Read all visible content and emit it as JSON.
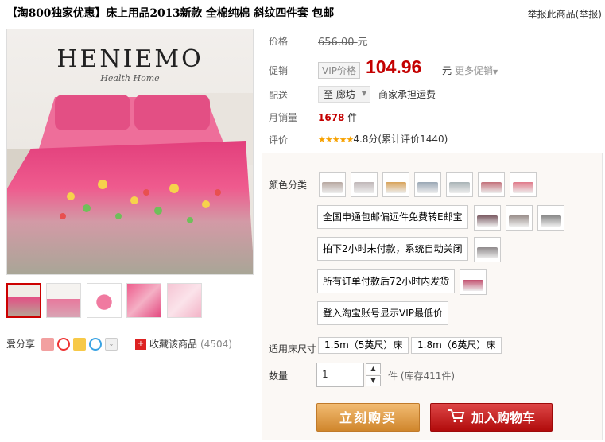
{
  "title": "【淘800独家优惠】床上用品2013新款 全棉纯棉 斜纹四件套 包邮",
  "report_link": "举报此商品(举报)",
  "gallery": {
    "brand": "HENIEMO",
    "brand_sub": "Health Home"
  },
  "share": {
    "label": "爱分享"
  },
  "favorite": {
    "label": "收藏该商品",
    "count": "(4504)"
  },
  "price": {
    "label": "价格",
    "original": "656.00",
    "unit": "元"
  },
  "promo": {
    "label": "促销",
    "tag": "VIP价格",
    "price": "104.96",
    "unit": "元",
    "more": "更多促销"
  },
  "shipping": {
    "label": "配送",
    "location": "至 廊坊",
    "note": "商家承担运费"
  },
  "monthly_sales": {
    "label": "月销量",
    "value": "1678",
    "unit": "件"
  },
  "rating": {
    "label": "评价",
    "stars": "★★★★★",
    "score": "4.8分",
    "count": "(累计评价1440)"
  },
  "sku": {
    "color_label": "颜色分类",
    "options": [
      "全国申通包邮偏远件免费转E邮宝",
      "拍下2小时未付款，系统自动关闭",
      "所有订单付款后72小时内发货",
      "登入淘宝账号显示VIP最低价"
    ],
    "size_label": "适用床尺寸",
    "sizes": [
      "1.5m（5英尺）床",
      "1.8m（6英尺）床"
    ],
    "qty_label": "数量",
    "qty_value": "1",
    "qty_unit": "件",
    "stock": "(库存411件)"
  },
  "actions": {
    "buy": "立刻购买",
    "cart": "加入购物车"
  },
  "colors": {
    "price_red": "#c40000",
    "buy_orange": "#e0a050",
    "cart_red": "#c41a1a"
  }
}
